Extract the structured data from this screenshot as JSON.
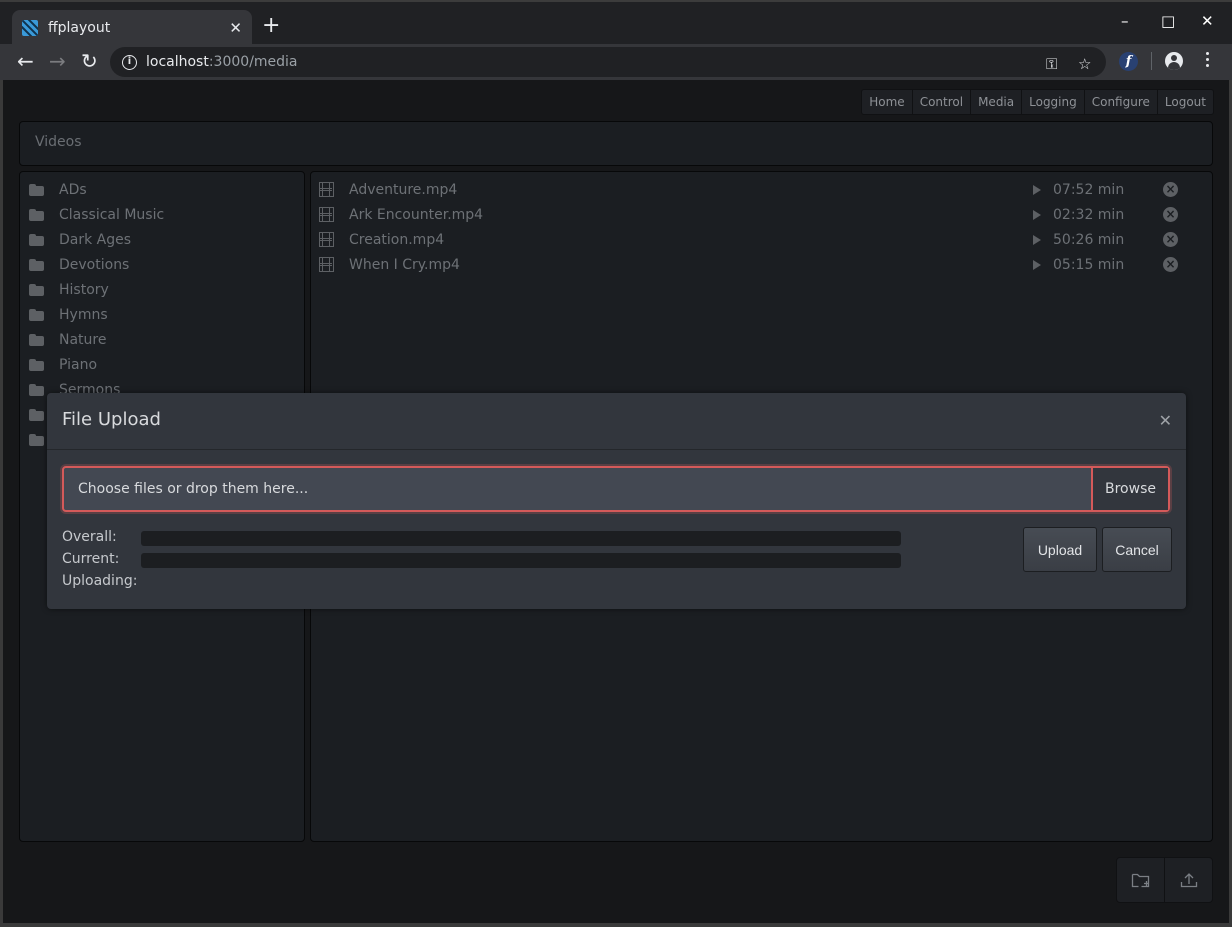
{
  "browser": {
    "tab_title": "ffplayout",
    "url_host": "localhost",
    "url_path": ":3000/media",
    "window_controls": {
      "minimize": "–",
      "maximize": "□",
      "close": "✕"
    }
  },
  "nav": {
    "items": [
      {
        "label": "Home"
      },
      {
        "label": "Control"
      },
      {
        "label": "Media"
      },
      {
        "label": "Logging"
      },
      {
        "label": "Configure"
      },
      {
        "label": "Logout"
      }
    ]
  },
  "breadcrumb": {
    "label": "Videos"
  },
  "folders": [
    {
      "name": "ADs"
    },
    {
      "name": "Classical Music"
    },
    {
      "name": "Dark Ages"
    },
    {
      "name": "Devotions"
    },
    {
      "name": "History"
    },
    {
      "name": "Hymns"
    },
    {
      "name": "Nature"
    },
    {
      "name": "Piano"
    },
    {
      "name": "Sermons"
    },
    {
      "name": ""
    },
    {
      "name": ""
    }
  ],
  "files": [
    {
      "name": "Adventure.mp4",
      "duration": "07:52 min"
    },
    {
      "name": "Ark Encounter.mp4",
      "duration": "02:32 min"
    },
    {
      "name": "Creation.mp4",
      "duration": "50:26 min"
    },
    {
      "name": "When I Cry.mp4",
      "duration": "05:15 min"
    }
  ],
  "upload_modal": {
    "title": "File Upload",
    "close_glyph": "✕",
    "file_placeholder": "Choose files or drop them here...",
    "browse_label": "Browse",
    "overall_label": "Overall:",
    "current_label": "Current:",
    "uploading_label": "Uploading:",
    "uploading_value": "",
    "overall_progress": 0,
    "current_progress": 0,
    "upload_label": "Upload",
    "cancel_label": "Cancel"
  },
  "colors": {
    "accent_error": "#d45a5a",
    "page_bg": "#161719",
    "panel_bg": "#1b1e22",
    "modal_bg": "#32363d"
  }
}
